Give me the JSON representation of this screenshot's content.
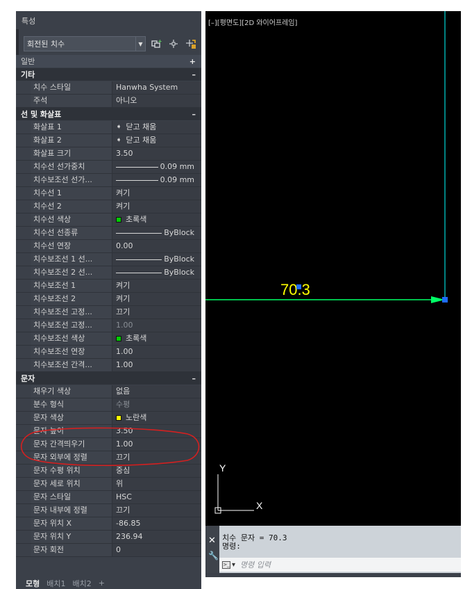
{
  "palette": {
    "title": "특성",
    "object_select": "회전된 치수",
    "sections": [
      {
        "title": "일반",
        "toggle": "+",
        "collapsed": true,
        "rows": []
      },
      {
        "title": "기타",
        "toggle": "–",
        "collapsed": false,
        "rows": [
          {
            "name": "치수 스타일",
            "value": "Hanwha System"
          },
          {
            "name": "주석",
            "value": "아니오"
          }
        ]
      },
      {
        "title": "선 및 화살표",
        "toggle": "–",
        "collapsed": false,
        "rows": [
          {
            "name": "화살표 1",
            "value": "닫고 채움",
            "kind": "arrow"
          },
          {
            "name": "화살표 2",
            "value": "닫고 채움",
            "kind": "arrow"
          },
          {
            "name": "화살표 크기",
            "value": "3.50"
          },
          {
            "name": "치수선 선가중치",
            "value": "0.09 mm",
            "kind": "line"
          },
          {
            "name": "치수보조선 선가...",
            "value": "0.09 mm",
            "kind": "line"
          },
          {
            "name": "치수선 1",
            "value": "켜기"
          },
          {
            "name": "치수선 2",
            "value": "켜기"
          },
          {
            "name": "치수선 색상",
            "value": "초록색",
            "kind": "color",
            "color": "#00cc00"
          },
          {
            "name": "치수선 선종류",
            "value": "ByBlock",
            "kind": "line"
          },
          {
            "name": "치수선 연장",
            "value": "0.00"
          },
          {
            "name": "치수보조선 1 선...",
            "value": "ByBlock",
            "kind": "line"
          },
          {
            "name": "치수보조선 2 선...",
            "value": "ByBlock",
            "kind": "line"
          },
          {
            "name": "치수보조선 1",
            "value": "켜기"
          },
          {
            "name": "치수보조선 2",
            "value": "켜기"
          },
          {
            "name": "치수보조선 고정...",
            "value": "끄기"
          },
          {
            "name": "치수보조선 고정...",
            "value": "1.00",
            "kind": "dim"
          },
          {
            "name": "치수보조선 색상",
            "value": "초록색",
            "kind": "color",
            "color": "#00cc00"
          },
          {
            "name": "치수보조선 연장",
            "value": "1.00"
          },
          {
            "name": "치수보조선 간격...",
            "value": "1.00"
          }
        ]
      },
      {
        "title": "문자",
        "toggle": "–",
        "collapsed": false,
        "rows": [
          {
            "name": "채우기 색상",
            "value": "없음"
          },
          {
            "name": "분수 형식",
            "value": "수평",
            "kind": "dim"
          },
          {
            "name": "문자 색상",
            "value": "노란색",
            "kind": "color",
            "color": "#ffff00"
          },
          {
            "name": "문자 높이",
            "value": "3.50"
          },
          {
            "name": "문자 간격띄우기",
            "value": "1.00"
          },
          {
            "name": "문자 외부에 정렬",
            "value": "끄기"
          },
          {
            "name": "문자 수평 위치",
            "value": "중심"
          },
          {
            "name": "문자 세로 위치",
            "value": "위"
          },
          {
            "name": "문자 스타일",
            "value": "HSC"
          },
          {
            "name": "문자 내부에 정렬",
            "value": "끄기"
          },
          {
            "name": "문자 위치 X",
            "value": "-86.85"
          },
          {
            "name": "문자 위치 Y",
            "value": "236.94"
          },
          {
            "name": "문자 회전",
            "value": "0"
          }
        ]
      }
    ],
    "tabs": [
      "모형",
      "배치1",
      "배치2",
      "+"
    ]
  },
  "viewport": {
    "label": "[–][평면도][2D 와이어프레임]",
    "dimension_text": "70.3",
    "ucs_x": "X",
    "ucs_y": "Y",
    "colors": {
      "dimension": "#00ff66",
      "text": "#ffff00",
      "grip": "#1e6bff",
      "extension": "#00cccc",
      "annotation": "#e02020"
    }
  },
  "command": {
    "history": [
      "치수 문자 = 70.3",
      "명령:"
    ],
    "placeholder": "명령 입력",
    "close_icon": "close-icon",
    "settings_icon": "wrench-icon"
  }
}
